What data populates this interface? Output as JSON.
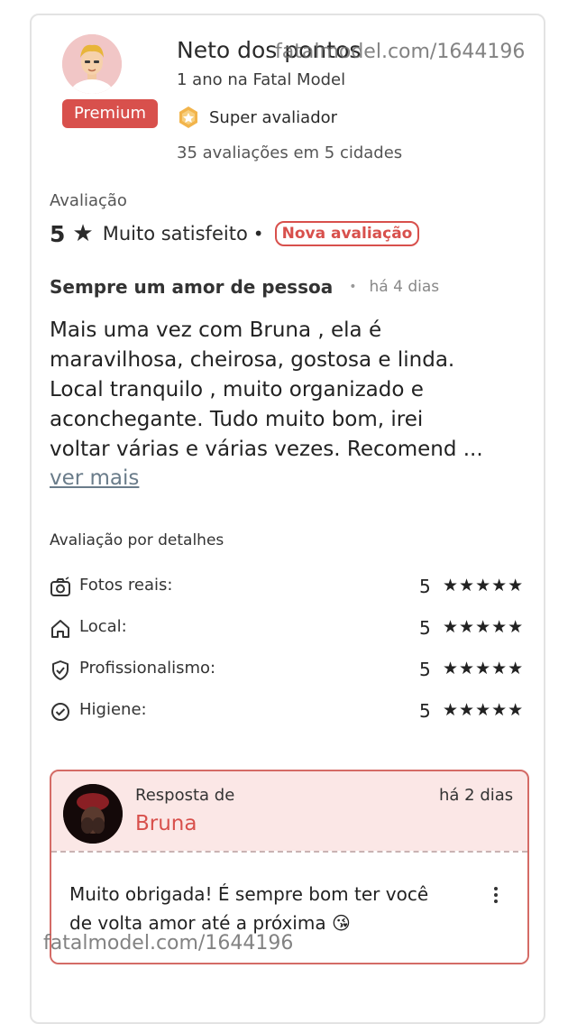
{
  "reviewer": {
    "name": "Neto dos pontos",
    "member_since": "1 ano na Fatal Model",
    "plan_badge": "Premium",
    "super_label": "Super avaliador",
    "reviews_summary": "35 avaliações em 5 cidades"
  },
  "watermark": "fatalmodel.com/1644196",
  "review": {
    "section_label": "Avaliação",
    "score": "5",
    "star": "★",
    "satisfaction": "Muito satisfeito",
    "separator": "•",
    "new_badge": "Nova avaliação",
    "title": "Sempre um amor de pessoa",
    "time_ago": "há 4 dias",
    "body": "Mais uma vez com Bruna , ela é\nmaravilhosa, cheirosa, gostosa e linda.\nLocal tranquilo , muito organizado e\naconchegante. Tudo muito bom, irei\nvoltar várias e várias vezes. Recomend ...",
    "see_more": "ver mais"
  },
  "details": {
    "label": "Avaliação por detalhes",
    "items": [
      {
        "name": "Fotos reais:",
        "score": "5",
        "stars": "★★★★★",
        "icon": "camera-icon"
      },
      {
        "name": "Local:",
        "score": "5",
        "stars": "★★★★★",
        "icon": "home-icon"
      },
      {
        "name": "Profissionalismo:",
        "score": "5",
        "stars": "★★★★★",
        "icon": "shield-check-icon"
      },
      {
        "name": "Higiene:",
        "score": "5",
        "stars": "★★★★★",
        "icon": "check-circle-icon"
      }
    ]
  },
  "reply": {
    "from_label": "Resposta de",
    "author": "Bruna",
    "time_ago": "há 2 dias",
    "text": "Muito obrigada! É sempre bom ter você\nde volta amor até a próxima 😘"
  },
  "colors": {
    "accent": "#d8504c",
    "reply_bg": "#fbe7e6",
    "border": "#e3e3e3",
    "link": "#6a7c8a"
  }
}
